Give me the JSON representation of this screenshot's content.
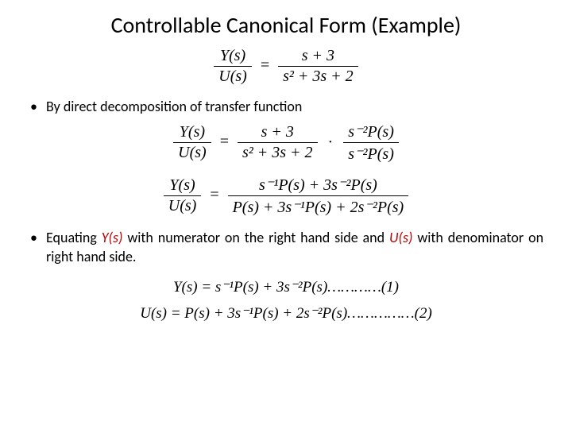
{
  "title": "Controllable Canonical Form (Example)",
  "bullets": {
    "b1": "By direct decomposition of transfer function",
    "b2_pre": "Equating ",
    "b2_y": "Y(s)",
    "b2_mid": " with numerator on the right hand side and ",
    "b2_u": "U(s)",
    "b2_post": " with denominator on right hand side."
  },
  "eq1": {
    "lhs_num": "Y(s)",
    "lhs_den": "U(s)",
    "eq": "=",
    "rhs_num": "s + 3",
    "rhs_den": "s² + 3s + 2"
  },
  "eq2": {
    "lhs_num": "Y(s)",
    "lhs_den": "U(s)",
    "eq": "=",
    "mid_num": "s + 3",
    "mid_den": "s² + 3s + 2",
    "dot": "·",
    "r_num": "s⁻²P(s)",
    "r_den": "s⁻²P(s)"
  },
  "eq3": {
    "lhs_num": "Y(s)",
    "lhs_den": "U(s)",
    "eq": "=",
    "r_num": "s⁻¹P(s) + 3s⁻²P(s)",
    "r_den": "P(s) + 3s⁻¹P(s) + 2s⁻²P(s)"
  },
  "eq4": "Y(s) = s⁻¹P(s) + 3s⁻²P(s)…………(1)",
  "eq5": "U(s) = P(s) + 3s⁻¹P(s) + 2s⁻²P(s)……………(2)"
}
